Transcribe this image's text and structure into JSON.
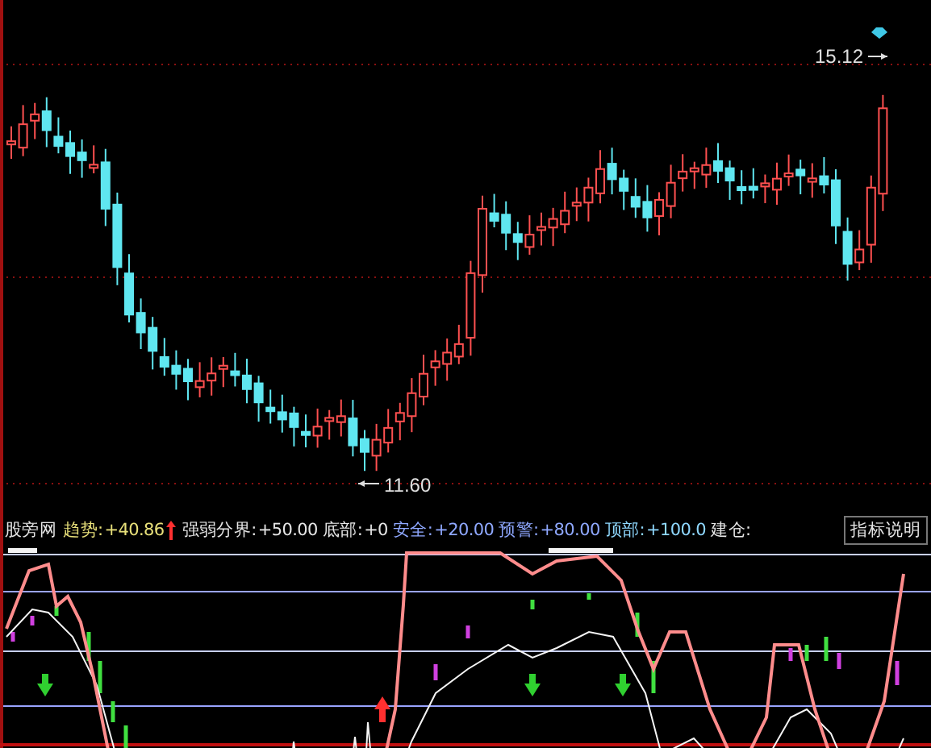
{
  "price_chart": {
    "high_label": "15.12",
    "low_label": "11.60"
  },
  "indicator_bar": {
    "name": "股旁网",
    "trend_up": true,
    "items": [
      {
        "label": "趋势:",
        "value": "+40.86",
        "color": "#e8e07a"
      },
      {
        "label": "强弱分界:",
        "value": "+50.00",
        "color": "#e6e6e6"
      },
      {
        "label": "底部:",
        "value": "+0",
        "color": "#e6e6e6"
      },
      {
        "label": "安全:",
        "value": "+20.00",
        "color": "#8fa8ff"
      },
      {
        "label": "预警:",
        "value": "+80.00",
        "color": "#8fa8ff"
      },
      {
        "label": "顶部:",
        "value": "+100.0",
        "color": "#8fd8ff"
      },
      {
        "label": "建仓:",
        "value": "",
        "color": "#e6e6e6"
      }
    ],
    "button": "指标说明"
  }
}
